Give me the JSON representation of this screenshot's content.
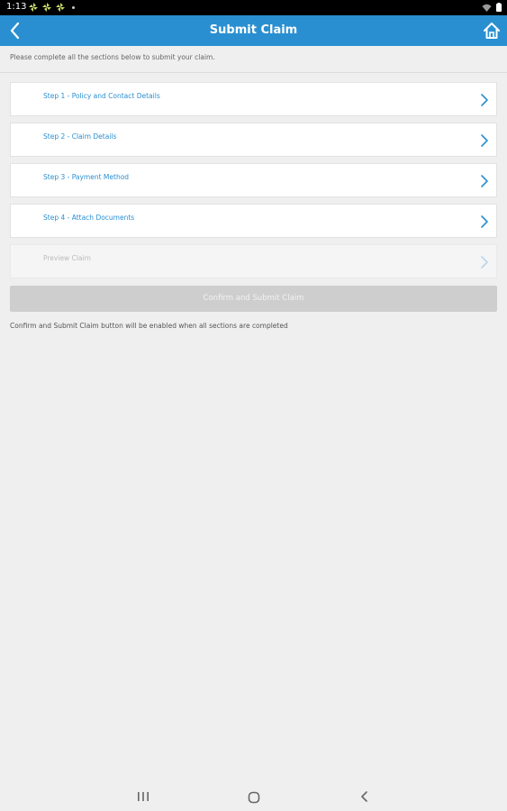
{
  "status_bar": {
    "time": "1:13",
    "icons_left": [
      "pinwheel-icon",
      "pinwheel-icon",
      "pinwheel-icon",
      "dot-icon"
    ],
    "icons_right": [
      "wifi-icon",
      "battery-icon"
    ]
  },
  "header": {
    "title": "Submit Claim",
    "back_icon": "chevron-left-icon",
    "home_icon": "home-icon",
    "background_color": "#2a8fd1"
  },
  "instructions": "Please complete all the sections below to submit your claim.",
  "steps": [
    {
      "label": "Step 1 - Policy and Contact Details",
      "enabled": true
    },
    {
      "label": "Step 2 - Claim Details",
      "enabled": true
    },
    {
      "label": "Step 3 - Payment Method",
      "enabled": true
    },
    {
      "label": "Step 4 - Attach Documents",
      "enabled": true
    },
    {
      "label": "Preview Claim",
      "enabled": false
    }
  ],
  "submit_button": {
    "label": "Confirm and Submit Claim",
    "enabled": false
  },
  "submit_note": "Confirm and Submit Claim button will be enabled when all sections are completed",
  "nav_bar": {
    "icons": [
      "recents-icon",
      "home-circle-icon",
      "back-icon"
    ]
  },
  "colors": {
    "accent": "#2a8fd1",
    "background": "#efefef",
    "disabled": "#cecece"
  }
}
